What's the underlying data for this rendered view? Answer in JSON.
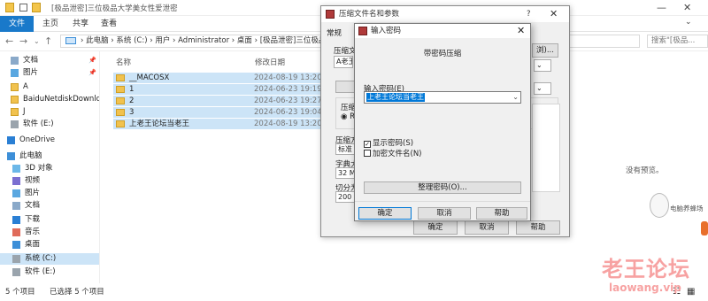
{
  "explorer": {
    "title": "[极品泄密]三位极品大学美女性爱泄密",
    "tabs": [
      "文件",
      "主页",
      "共享",
      "查看"
    ],
    "breadcrumb": "› 此电脑 › 系统 (C:) › 用户 › Administrator › 桌面 › [极品泄密]三位极品大",
    "search_placeholder": "搜索\"[极品...",
    "sidebar": [
      {
        "label": "文档",
        "icon": "document-icon",
        "pinned": true
      },
      {
        "label": "图片",
        "icon": "picture-icon",
        "pinned": true
      },
      {
        "label": "A",
        "icon": "folder-icon"
      },
      {
        "label": "BaiduNetdiskDownlc",
        "icon": "folder-icon"
      },
      {
        "label": "J",
        "icon": "folder-icon"
      },
      {
        "label": "软件 (E:)",
        "icon": "drive-icon"
      },
      {
        "label": "OneDrive",
        "icon": "cloud-icon"
      },
      {
        "label": "此电脑",
        "icon": "computer-icon"
      },
      {
        "label": "3D 对象",
        "icon": "cube-icon"
      },
      {
        "label": "视频",
        "icon": "video-icon"
      },
      {
        "label": "图片",
        "icon": "picture-icon"
      },
      {
        "label": "文档",
        "icon": "document-icon"
      },
      {
        "label": "下载",
        "icon": "download-icon"
      },
      {
        "label": "音乐",
        "icon": "music-icon"
      },
      {
        "label": "桌面",
        "icon": "desktop-icon"
      },
      {
        "label": "系统 (C:)",
        "icon": "drive-icon",
        "selected": true
      },
      {
        "label": "软件 (E:)",
        "icon": "drive-icon"
      }
    ],
    "columns": {
      "name": "名称",
      "modified": "修改日期"
    },
    "files": [
      {
        "name": "__MACOSX",
        "date": "2024-08-19 13:20"
      },
      {
        "name": "1",
        "date": "2024-06-23 19:19"
      },
      {
        "name": "2",
        "date": "2024-06-23 19:27"
      },
      {
        "name": "3",
        "date": "2024-06-23 19:04"
      },
      {
        "name": "上老王论坛当老王",
        "date": "2024-08-19 13:20"
      }
    ],
    "preview_text": "没有预览。",
    "status": {
      "count": "5 个项目",
      "selected": "已选择 5 个项目"
    }
  },
  "archive_dialog": {
    "title": "压缩文件名和参数",
    "help_mark": "?",
    "tab": "常规",
    "archive_name_label": "压缩文",
    "archive_name_value": "A老王",
    "browse_label": "浏)...",
    "format_label": "压缩文",
    "format_option": "RA",
    "method_label": "压缩方",
    "method_value": "标准",
    "dict_label": "字典大",
    "dict_value": "32 MB",
    "split_label": "切分为",
    "split_value": "200",
    "ok": "确定",
    "cancel": "取消",
    "help": "帮助"
  },
  "password_dialog": {
    "title": "输入密码",
    "heading": "带密码压缩",
    "password_label": "输入密码(E)",
    "password_value": "上老王论坛当老王",
    "show_password_label": "显示密码(S)",
    "show_password_checked": true,
    "encrypt_names_label": "加密文件名(N)",
    "encrypt_names_checked": false,
    "organize_button": "整理密码(O)...",
    "ok": "确定",
    "cancel": "取消",
    "help": "帮助"
  },
  "watermark": {
    "mascot_text": "电脑养蜂场",
    "site_cn": "老王论坛",
    "site_url": "laowang.vip"
  }
}
